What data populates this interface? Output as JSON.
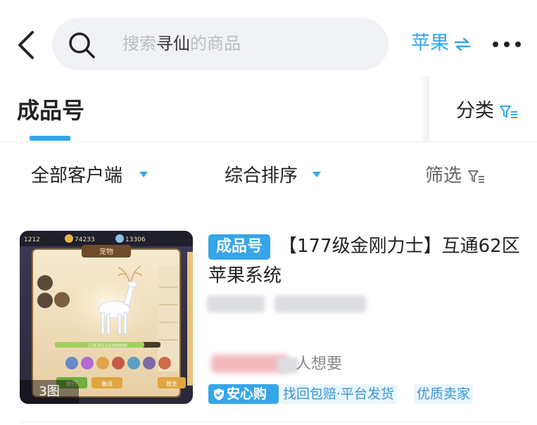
{
  "header": {
    "search_placeholder_before": "搜索",
    "search_keyword": "寻仙",
    "search_placeholder_after": "的商品",
    "platform_label": "苹果"
  },
  "tabs": {
    "active": "成品号",
    "category_label": "分类"
  },
  "filters": {
    "client": "全部客户端",
    "sort": "综合排序",
    "screen": "筛选"
  },
  "product": {
    "badge": "成品号",
    "title": "【177级金刚力士】互通62区苹果系统",
    "image_count": "3图",
    "want_suffix": "人想要",
    "tags": {
      "safe_buy": "安心购",
      "service": "找回包赔·平台发货",
      "seller": "优质卖家"
    },
    "thumb_game": {
      "currency_1": "1212",
      "currency_2": "74233",
      "currency_3": "13306",
      "panel_title": "宠物",
      "progress_text": "2787811/3290000",
      "button_1": "修行",
      "button_2": "备战",
      "button_3": "放生"
    }
  },
  "colors": {
    "accent": "#35a6e8",
    "tag_bg": "#eaf5fd",
    "search_bg": "#f1f2f6",
    "placeholder": "#b9bcc2"
  }
}
